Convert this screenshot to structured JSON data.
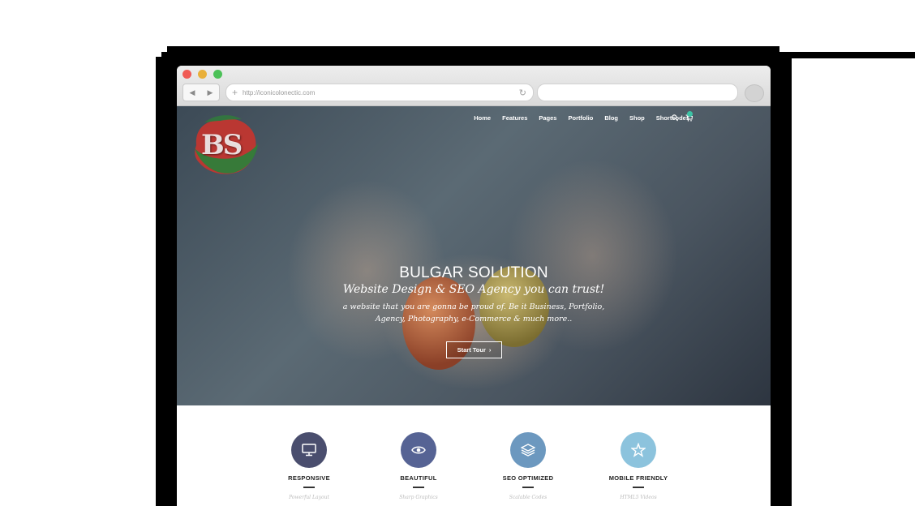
{
  "browser": {
    "back_icon": "◀",
    "forward_icon": "▶",
    "url": "http://iconicolonectic.com",
    "search_placeholder": ""
  },
  "site": {
    "logo_text": "BS",
    "nav": [
      "Home",
      "Features",
      "Pages",
      "Portfolio",
      "Blog",
      "Shop",
      "Shortcodes"
    ],
    "hero": {
      "title": "BULGAR SOLUTION",
      "subtitle": "Website Design & SEO Agency you can trust!",
      "description_line1": "a website that you are gonna be proud of. Be it Business, Portfolio,",
      "description_line2": "Agency, Photography, e-Commerce & much more..",
      "button_label": "Start Tour"
    },
    "features": [
      {
        "label": "RESPONSIVE",
        "caption": "Powerful Layout",
        "icon": "monitor-icon",
        "color": "#4a4e6e"
      },
      {
        "label": "BEAUTIFUL",
        "caption": "Sharp Graphics",
        "icon": "eye-icon",
        "color": "#566394"
      },
      {
        "label": "SEO OPTIMIZED",
        "caption": "Scalable Codes",
        "icon": "layers-icon",
        "color": "#6c98bf"
      },
      {
        "label": "MOBILE FRIENDLY",
        "caption": "HTML5 Videos",
        "icon": "star-icon",
        "color": "#8cc3dd"
      }
    ]
  },
  "colors": {
    "accent": "#3cc3a5"
  }
}
